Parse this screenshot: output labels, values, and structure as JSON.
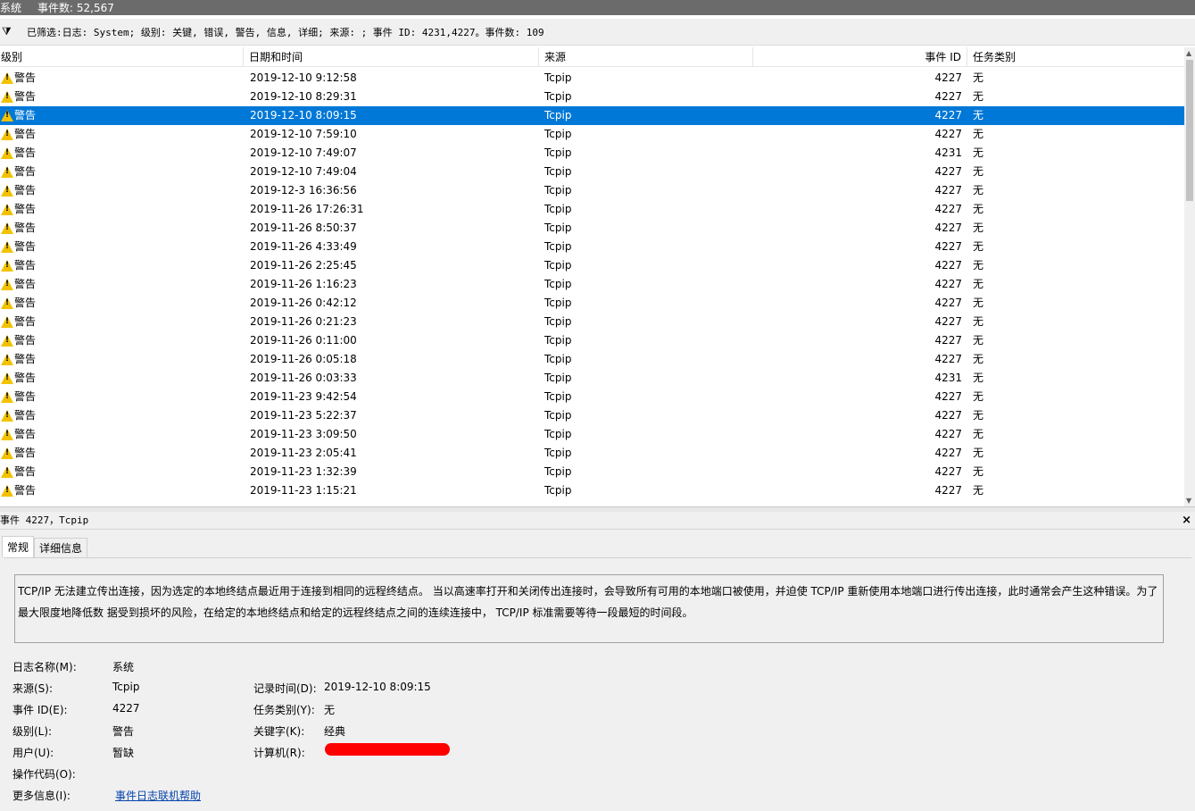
{
  "titlebar": {
    "log_name": "系统",
    "event_count": "事件数: 52,567"
  },
  "filterbar": {
    "icon": "filter-icon",
    "text": "已筛选:日志: System; 级别: 关键, 错误, 警告, 信息, 详细; 来源: ; 事件 ID: 4231,4227。事件数: 109"
  },
  "columns": {
    "level": "级别",
    "datetime": "日期和时间",
    "source": "来源",
    "event_id": "事件 ID",
    "task": "任务类别"
  },
  "rows": [
    {
      "level": "警告",
      "datetime": "2019-12-10 9:12:58",
      "source": "Tcpip",
      "event_id": "4227",
      "task": "无"
    },
    {
      "level": "警告",
      "datetime": "2019-12-10 8:29:31",
      "source": "Tcpip",
      "event_id": "4227",
      "task": "无"
    },
    {
      "level": "警告",
      "datetime": "2019-12-10 8:09:15",
      "source": "Tcpip",
      "event_id": "4227",
      "task": "无"
    },
    {
      "level": "警告",
      "datetime": "2019-12-10 7:59:10",
      "source": "Tcpip",
      "event_id": "4227",
      "task": "无"
    },
    {
      "level": "警告",
      "datetime": "2019-12-10 7:49:07",
      "source": "Tcpip",
      "event_id": "4231",
      "task": "无"
    },
    {
      "level": "警告",
      "datetime": "2019-12-10 7:49:04",
      "source": "Tcpip",
      "event_id": "4227",
      "task": "无"
    },
    {
      "level": "警告",
      "datetime": "2019-12-3 16:36:56",
      "source": "Tcpip",
      "event_id": "4227",
      "task": "无"
    },
    {
      "level": "警告",
      "datetime": "2019-11-26 17:26:31",
      "source": "Tcpip",
      "event_id": "4227",
      "task": "无"
    },
    {
      "level": "警告",
      "datetime": "2019-11-26 8:50:37",
      "source": "Tcpip",
      "event_id": "4227",
      "task": "无"
    },
    {
      "level": "警告",
      "datetime": "2019-11-26 4:33:49",
      "source": "Tcpip",
      "event_id": "4227",
      "task": "无"
    },
    {
      "level": "警告",
      "datetime": "2019-11-26 2:25:45",
      "source": "Tcpip",
      "event_id": "4227",
      "task": "无"
    },
    {
      "level": "警告",
      "datetime": "2019-11-26 1:16:23",
      "source": "Tcpip",
      "event_id": "4227",
      "task": "无"
    },
    {
      "level": "警告",
      "datetime": "2019-11-26 0:42:12",
      "source": "Tcpip",
      "event_id": "4227",
      "task": "无"
    },
    {
      "level": "警告",
      "datetime": "2019-11-26 0:21:23",
      "source": "Tcpip",
      "event_id": "4227",
      "task": "无"
    },
    {
      "level": "警告",
      "datetime": "2019-11-26 0:11:00",
      "source": "Tcpip",
      "event_id": "4227",
      "task": "无"
    },
    {
      "level": "警告",
      "datetime": "2019-11-26 0:05:18",
      "source": "Tcpip",
      "event_id": "4227",
      "task": "无"
    },
    {
      "level": "警告",
      "datetime": "2019-11-26 0:03:33",
      "source": "Tcpip",
      "event_id": "4231",
      "task": "无"
    },
    {
      "level": "警告",
      "datetime": "2019-11-23 9:42:54",
      "source": "Tcpip",
      "event_id": "4227",
      "task": "无"
    },
    {
      "level": "警告",
      "datetime": "2019-11-23 5:22:37",
      "source": "Tcpip",
      "event_id": "4227",
      "task": "无"
    },
    {
      "level": "警告",
      "datetime": "2019-11-23 3:09:50",
      "source": "Tcpip",
      "event_id": "4227",
      "task": "无"
    },
    {
      "level": "警告",
      "datetime": "2019-11-23 2:05:41",
      "source": "Tcpip",
      "event_id": "4227",
      "task": "无"
    },
    {
      "level": "警告",
      "datetime": "2019-11-23 1:32:39",
      "source": "Tcpip",
      "event_id": "4227",
      "task": "无"
    },
    {
      "level": "警告",
      "datetime": "2019-11-23 1:15:21",
      "source": "Tcpip",
      "event_id": "4227",
      "task": "无"
    }
  ],
  "selected_row": 2,
  "event_header": {
    "title": "事件 4227，Tcpip",
    "close": "×"
  },
  "tabs": [
    "常规",
    "详细信息"
  ],
  "description": "TCP/IP 无法建立传出连接，因为选定的本地终结点最近用于连接到相同的远程终结点。 当以高速率打开和关闭传出连接时，会导致所有可用的本地端口被使用，并迫使 TCP/IP  重新使用本地端口进行传出连接，此时通常会产生这种错误。为了最大限度地降低数 据受到损坏的风险，在给定的本地终结点和给定的远程终结点之间的连续连接中， TCP/IP 标准需要等待一段最短的时间段。",
  "fields": {
    "log_name_label": "日志名称(M):",
    "log_name": "系统",
    "source_label": "来源(S):",
    "source": "Tcpip",
    "logged_label": "记录时间(D):",
    "logged": "2019-12-10 8:09:15",
    "event_id_label": "事件 ID(E):",
    "event_id": "4227",
    "task_label": "任务类别(Y):",
    "task": "无",
    "level_label": "级别(L):",
    "level": "警告",
    "keywords_label": "关键字(K):",
    "keywords": "经典",
    "user_label": "用户(U):",
    "user": "暂缺",
    "computer_label": "计算机(R):",
    "opcode_label": "操作代码(O):",
    "more_info_label": "更多信息(I):",
    "more_info_link": "事件日志联机帮助"
  },
  "colors": {
    "selection": "#0078d7",
    "warning": "#f2c200",
    "redaction": "#ff0000"
  }
}
